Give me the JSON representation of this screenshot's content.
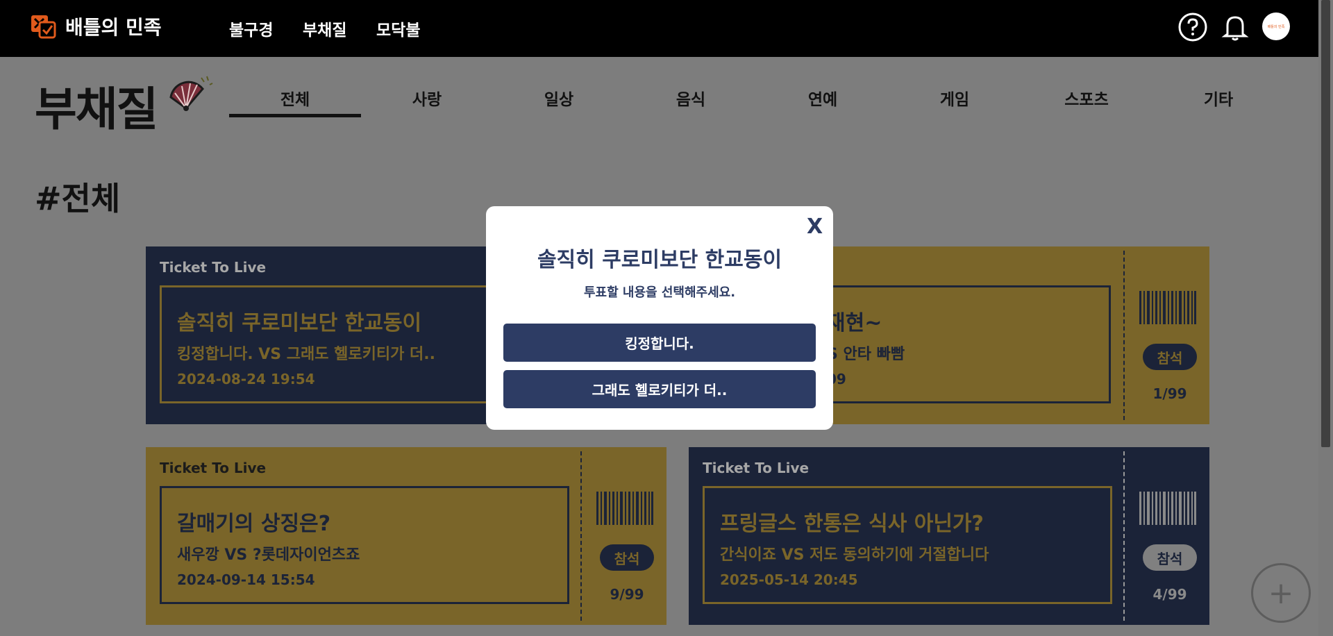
{
  "header": {
    "brand": "배틀의 민족",
    "nav": [
      "불구경",
      "부채질",
      "모닥불"
    ],
    "avatar_text": "배틀의 민족"
  },
  "page": {
    "title": "부채질",
    "categories": [
      "전체",
      "사랑",
      "일상",
      "음식",
      "연예",
      "게임",
      "스포츠",
      "기타"
    ],
    "section_title": "#전체"
  },
  "tickets": [
    {
      "head": "Ticket To Live",
      "title": "솔직히 쿠로미보단 한교동이",
      "vs": "킹정합니다. VS 그래도 헬로키티가 더..",
      "date": "2024-08-24 19:54",
      "badge": "",
      "count": ""
    },
    {
      "head": "",
      "title": "재현~",
      "vs": "S 안타 빠빰",
      "date": "09",
      "badge": "참석",
      "count": "1/99"
    },
    {
      "head": "Ticket To Live",
      "title": "갈매기의 상징은?",
      "vs": "새우깡 VS ?롯데자이언츠죠",
      "date": "2024-09-14 15:54",
      "badge": "참석",
      "count": "9/99"
    },
    {
      "head": "Ticket To Live",
      "title": "프링글스 한통은 식사 아닌가?",
      "vs": "간식이죠 VS 저도 동의하기에 거절합니다",
      "date": "2025-05-14 20:45",
      "badge": "참석",
      "count": "4/99"
    }
  ],
  "modal": {
    "close": "X",
    "title": "솔직히 쿠로미보단 한교동이",
    "subtitle": "투표할 내용을 선택해주세요.",
    "choices": [
      "킹정합니다.",
      "그래도 헬로키티가 더.."
    ]
  },
  "add_button": "+",
  "colors": {
    "navy": "#1b2338",
    "gold": "#7a6529",
    "modal_accent": "#2d3c64",
    "brand_orange": "#e05a1c"
  }
}
